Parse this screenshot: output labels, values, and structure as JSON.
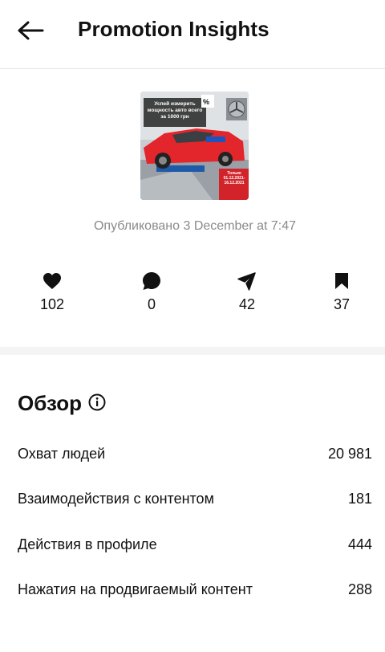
{
  "header": {
    "title": "Promotion Insights",
    "back_icon": "arrow-left-icon"
  },
  "post": {
    "thumb_headline": "Успей измерить мощность авто всего за 1000 грн",
    "thumb_dates": "Только 01.12.2021-16.12.2021",
    "published": "Опубликовано 3 December at 7:47"
  },
  "stats": {
    "likes": "102",
    "comments": "0",
    "shares": "42",
    "saves": "37"
  },
  "overview": {
    "title": "Обзор",
    "rows": [
      {
        "label": "Охват людей",
        "value": "20 981"
      },
      {
        "label": "Взаимодействия с контентом",
        "value": "181"
      },
      {
        "label": "Действия в профиле",
        "value": "444"
      },
      {
        "label": "Нажатия на продвигаемый контент",
        "value": "288"
      }
    ]
  },
  "colors": {
    "text": "#111111",
    "muted": "#8a8a8a",
    "divider": "#f4f4f4",
    "car_red": "#e3262b"
  }
}
